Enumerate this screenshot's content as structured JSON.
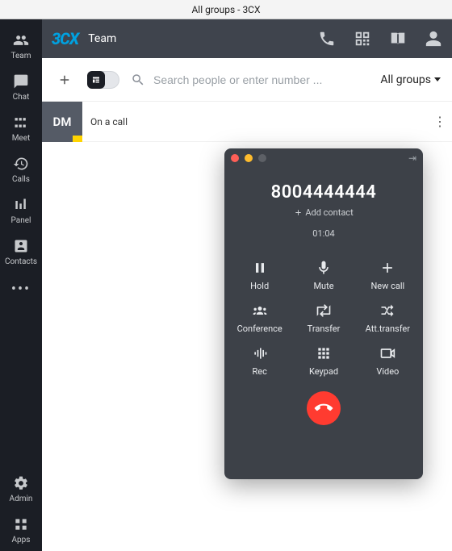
{
  "window": {
    "title": "All groups - 3CX"
  },
  "brand": {
    "logo": "3CX"
  },
  "topbar": {
    "title": "Team"
  },
  "sidebar": {
    "items": [
      {
        "label": "Team"
      },
      {
        "label": "Chat"
      },
      {
        "label": "Meet"
      },
      {
        "label": "Calls"
      },
      {
        "label": "Panel"
      },
      {
        "label": "Contacts"
      }
    ],
    "bottom": [
      {
        "label": "Admin"
      },
      {
        "label": "Apps"
      }
    ]
  },
  "toolbar": {
    "search_placeholder": "Search people or enter number ...",
    "group_selector": "All groups"
  },
  "list": {
    "items": [
      {
        "initials": "DM",
        "status": "On a call"
      }
    ]
  },
  "call": {
    "number": "8004444444",
    "add_contact": "Add contact",
    "duration": "01:04",
    "buttons": {
      "hold": "Hold",
      "mute": "Mute",
      "newcall": "New call",
      "conference": "Conference",
      "transfer": "Transfer",
      "atttransfer": "Att.transfer",
      "rec": "Rec",
      "keypad": "Keypad",
      "video": "Video"
    }
  }
}
